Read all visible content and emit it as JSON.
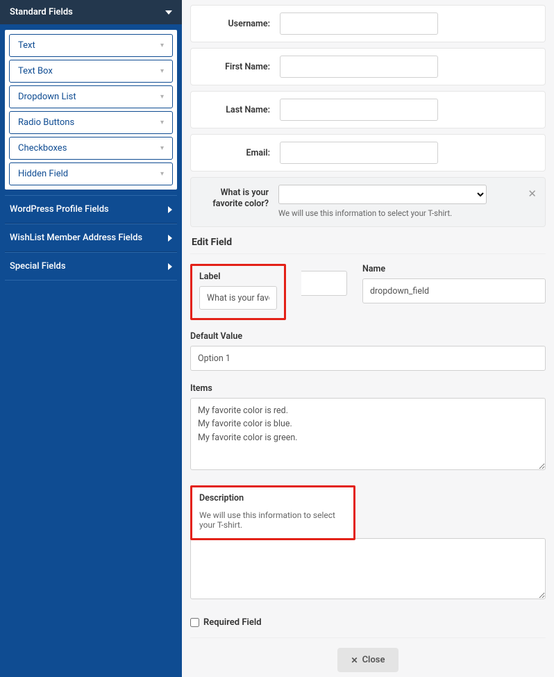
{
  "sidebar": {
    "header": "Standard Fields",
    "items": [
      {
        "label": "Text"
      },
      {
        "label": "Text Box"
      },
      {
        "label": "Dropdown List"
      },
      {
        "label": "Radio Buttons"
      },
      {
        "label": "Checkboxes"
      },
      {
        "label": "Hidden Field"
      }
    ],
    "sections": [
      {
        "label": "WordPress Profile Fields"
      },
      {
        "label": "WishList Member Address Fields"
      },
      {
        "label": "Special Fields"
      }
    ]
  },
  "form_rows": [
    {
      "label": "Username:"
    },
    {
      "label": "First Name:"
    },
    {
      "label": "Last Name:"
    },
    {
      "label": "Email:"
    }
  ],
  "question": {
    "label": "What is your favorite color?",
    "help": "We will use this information to select your T-shirt."
  },
  "edit": {
    "title": "Edit Field",
    "label_lbl": "Label",
    "label_val": "What is your favorite color?",
    "name_lbl": "Name",
    "name_val": "dropdown_field",
    "default_lbl": "Default Value",
    "default_val": "Option 1",
    "items_lbl": "Items",
    "items_val": "My favorite color is red.\nMy favorite color is blue.\nMy favorite color is green.",
    "desc_lbl": "Description",
    "desc_val": "We will use this information to select your T-shirt.",
    "required_lbl": "Required Field",
    "close_btn": "Close"
  }
}
